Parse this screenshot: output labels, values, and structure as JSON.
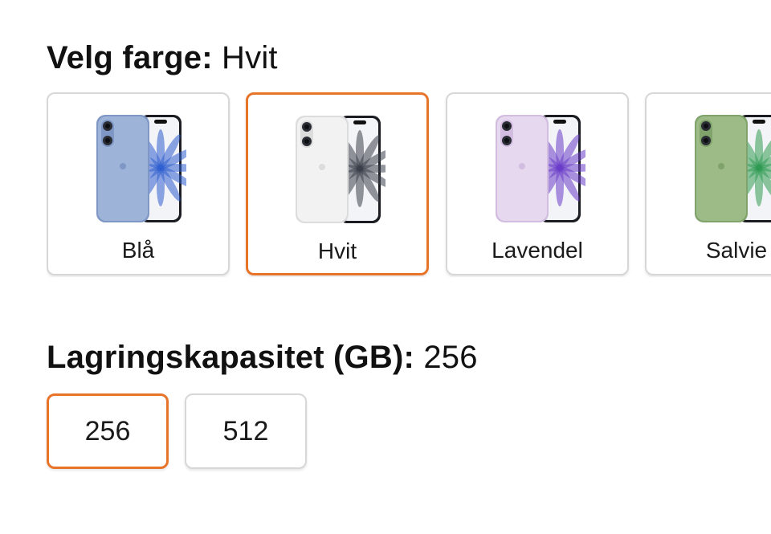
{
  "color_section": {
    "label": "Velg farge:",
    "selected_value": "Hvit",
    "options": [
      {
        "name": "Blå",
        "selected": false,
        "body": "#9db4d8",
        "body_dark": "#7e97c4",
        "petal": "#2f5fd0"
      },
      {
        "name": "Hvit",
        "selected": true,
        "body": "#f2f2f2",
        "body_dark": "#dcdcdc",
        "petal": "#3a3f4a"
      },
      {
        "name": "Lavendel",
        "selected": false,
        "body": "#e6d8ee",
        "body_dark": "#d2bde0",
        "petal": "#6a3cc8"
      },
      {
        "name": "Salvie",
        "selected": false,
        "body": "#9cbb86",
        "body_dark": "#7fa36a",
        "petal": "#2f9a52"
      }
    ]
  },
  "storage_section": {
    "label": "Lagringskapasitet (GB):",
    "selected_value": "256",
    "options": [
      {
        "label": "256",
        "selected": true
      },
      {
        "label": "512",
        "selected": false
      }
    ]
  },
  "colors": {
    "accent": "#e8742a",
    "border": "#d7d7d7",
    "text": "#111111"
  }
}
